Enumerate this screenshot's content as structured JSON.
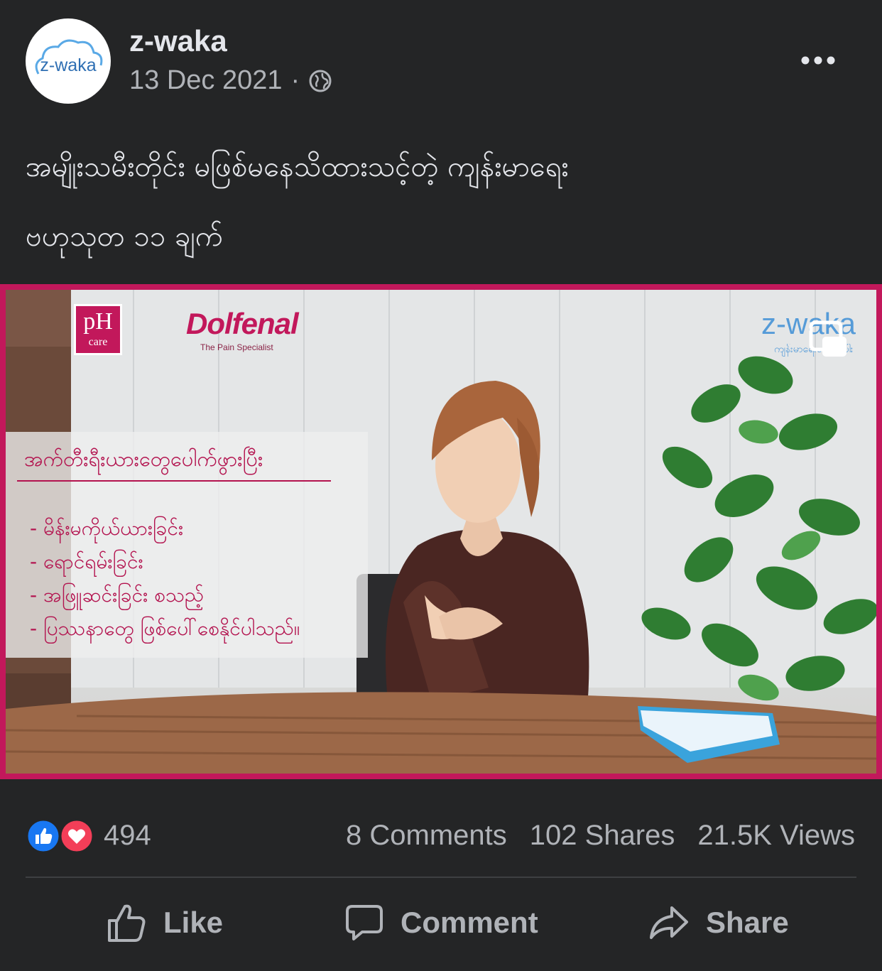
{
  "post": {
    "author": "z-waka",
    "date": "13 Dec 2021",
    "separator": "·",
    "privacy_icon": "globe-icon",
    "more_icon": "more-options-icon",
    "avatar_text": "z-waka",
    "caption_line1": "အမျိုးသမီးတိုင်း မဖြစ်မနေသိထားသင့်တဲ့ ကျန်းမာရေး",
    "caption_line2": "ဗဟုသုတ ၁၁ ချက်"
  },
  "video": {
    "logo_ph": "pH",
    "logo_ph_sub": "care",
    "brand": "Dolfenal",
    "brand_tagline": "The Pain Specialist",
    "watermark": "z-waka",
    "watermark_sub": "ကျန်းမာရေးဆောင်းပါး",
    "overlay_title": "အက်တီးရီးယားတွေပေါက်ဖွားပြီး",
    "overlay_items": [
      "- မိန်းမကိုယ်ယားခြင်း",
      "- ရောင်ရမ်းခြင်း",
      "- အဖြူဆင်းခြင်း စသည့်",
      "- ပြဿနာတွေ ဖြစ်ပေါ်စေနိုင်ပါသည်။"
    ],
    "accent_color": "#c2185b"
  },
  "stats": {
    "reaction_icons": [
      "like-icon",
      "love-icon"
    ],
    "reactions_count": "494",
    "comments": "8 Comments",
    "shares": "102 Shares",
    "views": "21.5K Views"
  },
  "actions": {
    "like": "Like",
    "comment": "Comment",
    "share": "Share"
  },
  "colors": {
    "background": "#242526",
    "text_primary": "#e4e6eb",
    "text_secondary": "#b0b3b8",
    "like_blue": "#1877f2",
    "love_red": "#f33e58"
  }
}
